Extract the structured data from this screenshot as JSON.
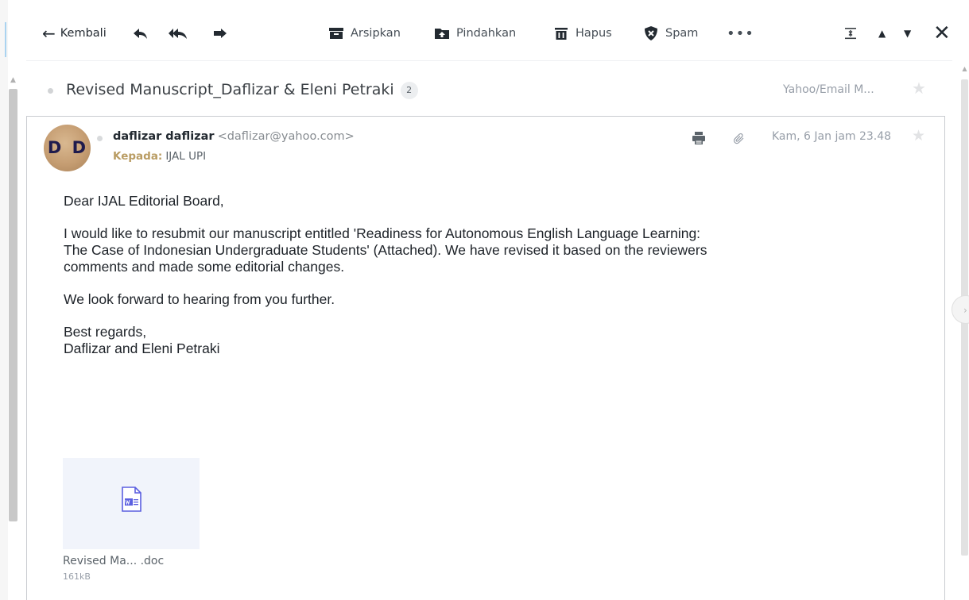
{
  "toolbar": {
    "back_label": "Kembali",
    "archive_label": "Arsipkan",
    "move_label": "Pindahkan",
    "delete_label": "Hapus",
    "spam_label": "Spam",
    "more_label": "•••",
    "close_label": "✕"
  },
  "thread": {
    "subject": "Revised Manuscript_Daflizar & Eleni Petraki",
    "message_count": "2",
    "folder": "Yahoo/Email M..."
  },
  "message": {
    "avatar_initials": "D D",
    "sender_name": "daflizar daflizar",
    "sender_email": "<daflizar@yahoo.com>",
    "to_label": "Kepada:",
    "to_name": "IJAL UPI",
    "date": "Kam, 6 Jan jam 23.48",
    "body": {
      "greeting": "Dear IJAL Editorial Board,",
      "paragraph1_line1": "I would like to resubmit our manuscript entitled 'Readiness for Autonomous English Language Learning:",
      "paragraph1_line2": "The Case of Indonesian Undergraduate Students' (Attached). We have revised it based on the reviewers",
      "paragraph1_line3": "comments and made some editorial changes.",
      "paragraph2": "We look forward to hearing from you further.",
      "closing": "Best regards,",
      "signature": "Daflizar and Eleni Petraki"
    },
    "attachment": {
      "name": "Revised Ma... .doc",
      "size": "161kB"
    }
  },
  "icons": {
    "back": "arrow-left-icon",
    "reply": "reply-icon",
    "reply_all": "reply-all-icon",
    "forward": "forward-icon",
    "archive": "archive-icon",
    "move": "move-folder-icon",
    "delete": "trash-icon",
    "spam": "shield-x-icon",
    "collapse": "collapse-icon",
    "print": "print-icon",
    "attachment": "paperclip-icon",
    "star": "star-icon",
    "word_doc": "word-document-icon"
  },
  "colors": {
    "text_primary": "#232a31",
    "text_secondary": "#979ea8",
    "to_label": "#b99c63",
    "card_border": "#c9ccd0",
    "attachment_bg": "#f1f4fb",
    "word_icon": "#5b5fe0"
  }
}
